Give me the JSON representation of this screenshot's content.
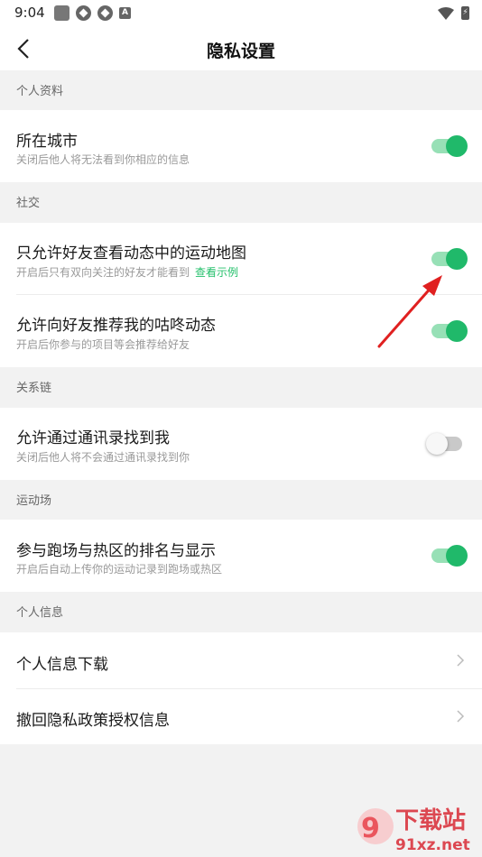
{
  "status_bar": {
    "time": "9:04",
    "a_badge": "A"
  },
  "header": {
    "title": "隐私设置"
  },
  "sections": [
    {
      "label": "个人资料"
    },
    {
      "label": "社交"
    },
    {
      "label": "关系链"
    },
    {
      "label": "运动场"
    },
    {
      "label": "个人信息"
    }
  ],
  "settings": {
    "city": {
      "title": "所在城市",
      "subtitle": "关闭后他人将无法看到你相应的信息",
      "enabled": true
    },
    "friends_map": {
      "title": "只允许好友查看动态中的运动地图",
      "subtitle": "开启后只有双向关注的好友才能看到",
      "link": "查看示例",
      "enabled": true
    },
    "recommend": {
      "title": "允许向好友推荐我的咕咚动态",
      "subtitle": "开启后你参与的项目等会推荐给好友",
      "enabled": true
    },
    "contacts": {
      "title": "允许通过通讯录找到我",
      "subtitle": "关闭后他人将不会通过通讯录找到你",
      "enabled": false
    },
    "ranking": {
      "title": "参与跑场与热区的排名与显示",
      "subtitle": "开启后自动上传你的运动记录到跑场或热区",
      "enabled": true
    },
    "download": {
      "title": "个人信息下载"
    },
    "revoke": {
      "title": "撤回隐私政策授权信息"
    }
  },
  "watermark": {
    "brand": "下载站",
    "site": "91xz.net"
  },
  "colors": {
    "accent": "#20b96a",
    "accent_track": "#97e0b6",
    "arrow": "#e02020"
  }
}
